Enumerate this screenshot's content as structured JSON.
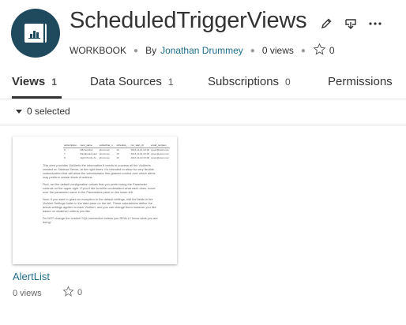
{
  "workbook": {
    "title": "ScheduledTriggerViews",
    "type_label": "WORKBOOK",
    "by_label": "By",
    "author": "Jonathan Drummey",
    "views_label": "0 views",
    "favorites_count": "0"
  },
  "icons": {
    "edit": "pencil-icon",
    "download": "download-icon",
    "more": "more-icon",
    "favorite": "star-icon"
  },
  "tabs": [
    {
      "label": "Views",
      "count": "1"
    },
    {
      "label": "Data Sources",
      "count": "1"
    },
    {
      "label": "Subscriptions",
      "count": "0"
    },
    {
      "label": "Permissions",
      "count": ""
    }
  ],
  "selection": {
    "label": "0 selected"
  },
  "view_card": {
    "title": "AlertList",
    "views_label": "0 views",
    "favorites_count": "0",
    "thumbnail": {
      "columns": [
        "subscription...",
        "view_name",
        "subscriber_n...",
        "schedule_...",
        "run_start_dt",
        "email_recipien"
      ],
      "rows": [
        [
          "9",
          "DB Sentinel",
          "jdrummey",
          "16",
          "2016-11-01 02:00",
          "tyson@scan.com"
        ],
        [
          "7",
          "Dashboard Alert",
          "jdrummey",
          "16",
          "2016-11-01 02:00",
          "tyson@scan.com"
        ],
        [
          "8",
          "High Priority Al...",
          "jdrummey",
          "16",
          "2016-11-02 02:00",
          "tyson@scan.com"
        ]
      ],
      "paragraphs": [
        "This view provides VizAlerts the information it needs to process all the VizAlerts created on Tableau Server, at the right times. It's intended to allow for very flexible customization that will allow the administrator fine-grained control over which alerts may perform certain kinds of actions.",
        "First, set the default configuration values that you prefer using the Parameter controls on the upper right. If you'd like to better understand what each does, hover over the parameter name in the Parameters pane on the lower left.",
        "Now, if you want to grant an exception to the default settings, edit the fields in the VizAlert Settings folder in the data pane on the left. These calculations define the actual settings applied to each VizAlert, and you can change them however you like based on whatever criteria you like.",
        "Do NOT change the custom SQL connection unless you REALLY know what you are doing!"
      ]
    }
  }
}
